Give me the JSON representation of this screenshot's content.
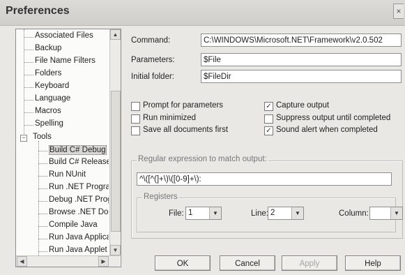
{
  "window": {
    "title": "Preferences",
    "close_label": "×"
  },
  "tree": {
    "items": [
      {
        "label": "Associated Files"
      },
      {
        "label": "Backup"
      },
      {
        "label": "File Name Filters"
      },
      {
        "label": "Folders"
      },
      {
        "label": "Keyboard"
      },
      {
        "label": "Language"
      },
      {
        "label": "Macros"
      },
      {
        "label": "Spelling"
      },
      {
        "label": "Tools"
      },
      {
        "label": "Build C# Debug"
      },
      {
        "label": "Build C# Release"
      },
      {
        "label": "Run NUnit"
      },
      {
        "label": "Run .NET Program"
      },
      {
        "label": "Debug .NET Program"
      },
      {
        "label": "Browse .NET Doc"
      },
      {
        "label": "Compile Java"
      },
      {
        "label": "Run Java Application"
      },
      {
        "label": "Run Java Applet"
      }
    ],
    "selected_index": 9,
    "expander_label": "−"
  },
  "form": {
    "command_label": "Command:",
    "command_value": "C:\\WINDOWS\\Microsoft.NET\\Framework\\v2.0.502",
    "parameters_label": "Parameters:",
    "parameters_value": "$File",
    "initial_folder_label": "Initial folder:",
    "initial_folder_value": "$FileDir"
  },
  "options": {
    "left": [
      {
        "label": "Prompt for parameters",
        "checked": false
      },
      {
        "label": "Run minimized",
        "checked": false
      },
      {
        "label": "Save all documents first",
        "checked": false
      }
    ],
    "right": [
      {
        "label": "Capture output",
        "checked": true
      },
      {
        "label": "Suppress output until completed",
        "checked": false
      },
      {
        "label": "Sound alert when completed",
        "checked": true
      }
    ]
  },
  "regex": {
    "group_title": "Regular expression to match output:",
    "value": "^\\([^(]+\\)\\([0-9]+\\):",
    "registers_title": "Registers",
    "file_label": "File:",
    "file_value": "1",
    "line_label": "Line:",
    "line_value": "2",
    "column_label": "Column:",
    "column_value": ""
  },
  "buttons": {
    "ok": "OK",
    "cancel": "Cancel",
    "apply": "Apply",
    "help": "Help"
  }
}
